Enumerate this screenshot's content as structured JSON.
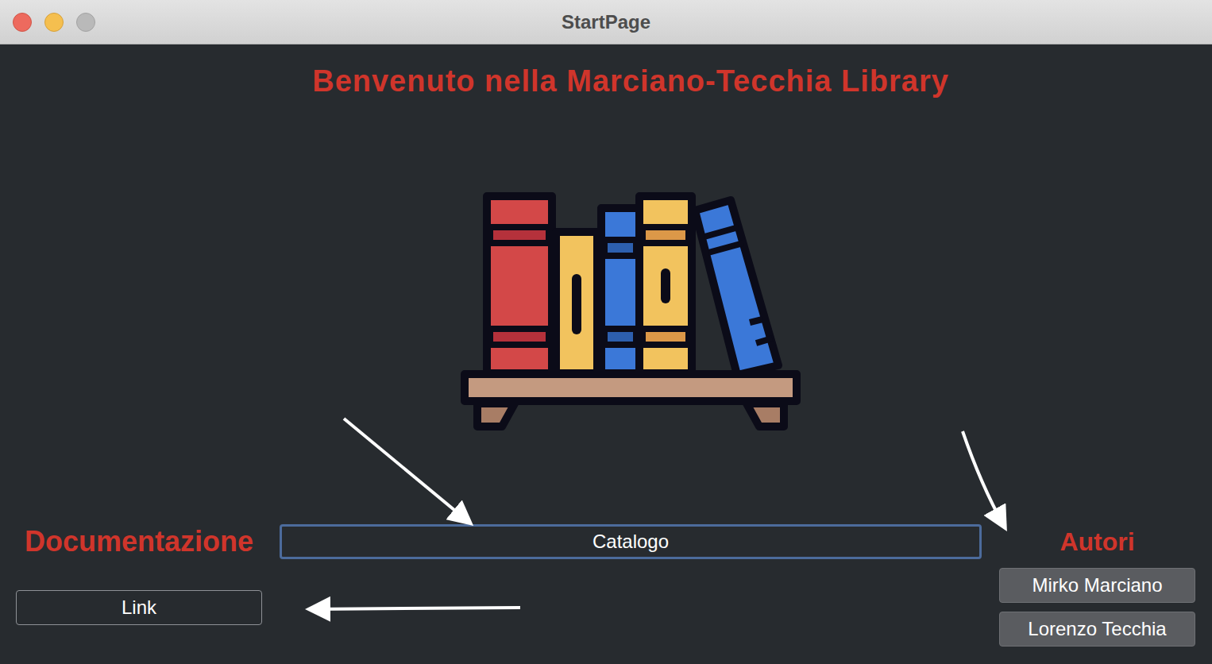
{
  "window": {
    "title": "StartPage"
  },
  "heading": "Benvenuto nella Marciano-Tecchia Library",
  "catalog_button": {
    "label": "Catalogo",
    "focused": true
  },
  "documentation": {
    "label": "Documentazione",
    "button": "Link"
  },
  "authors": {
    "label": "Autori",
    "buttons": [
      "Mirko Marciano",
      "Lorenzo Tecchia"
    ]
  }
}
